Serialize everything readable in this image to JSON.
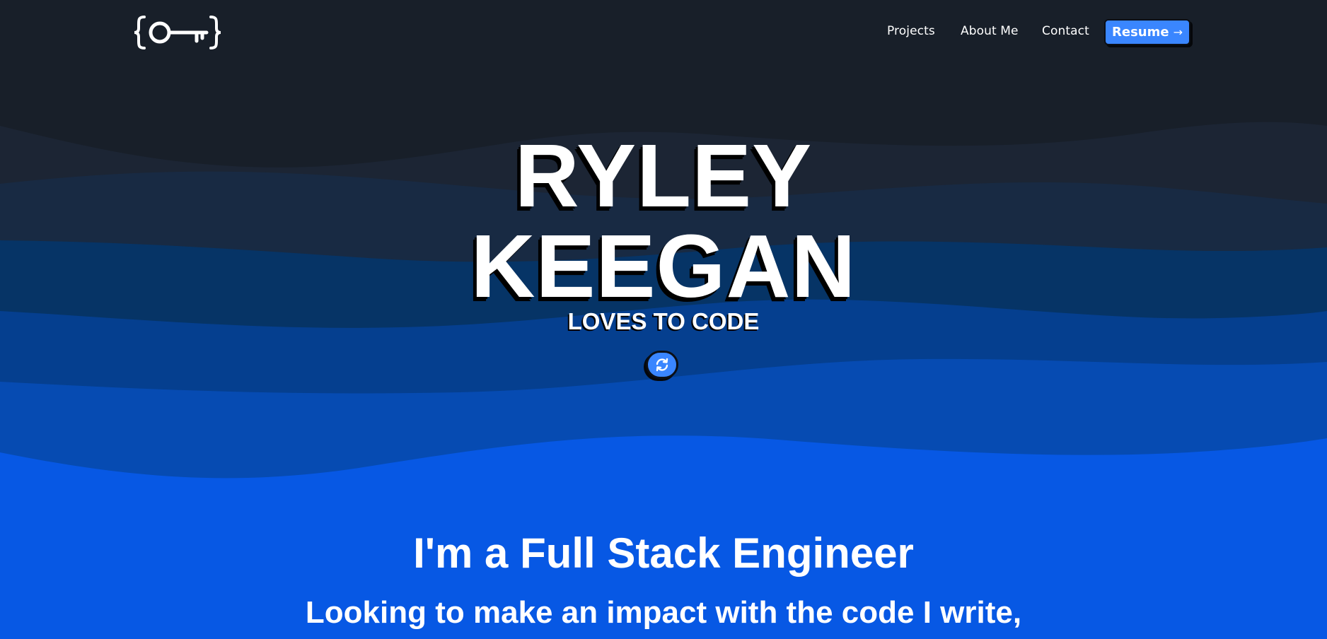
{
  "colors": {
    "background_dark": "#181f29",
    "accent_blue": "#3a86ff",
    "wave_blue": "#0758e4",
    "text": "#ffffff"
  },
  "header": {
    "logo_icon": "key-braces-icon",
    "nav": [
      {
        "label": "Projects"
      },
      {
        "label": "About Me"
      },
      {
        "label": "Contact"
      }
    ],
    "resume_label": "Resume",
    "resume_icon": "arrow-right-icon"
  },
  "hero": {
    "first_name": "RYLEY",
    "last_name": "KEEGAN",
    "tagline": "LOVES TO CODE",
    "refresh_icon": "refresh-icon"
  },
  "intro": {
    "title": "I'm a Full Stack Engineer",
    "subtitle": "Looking to make an impact with the code I write,"
  }
}
